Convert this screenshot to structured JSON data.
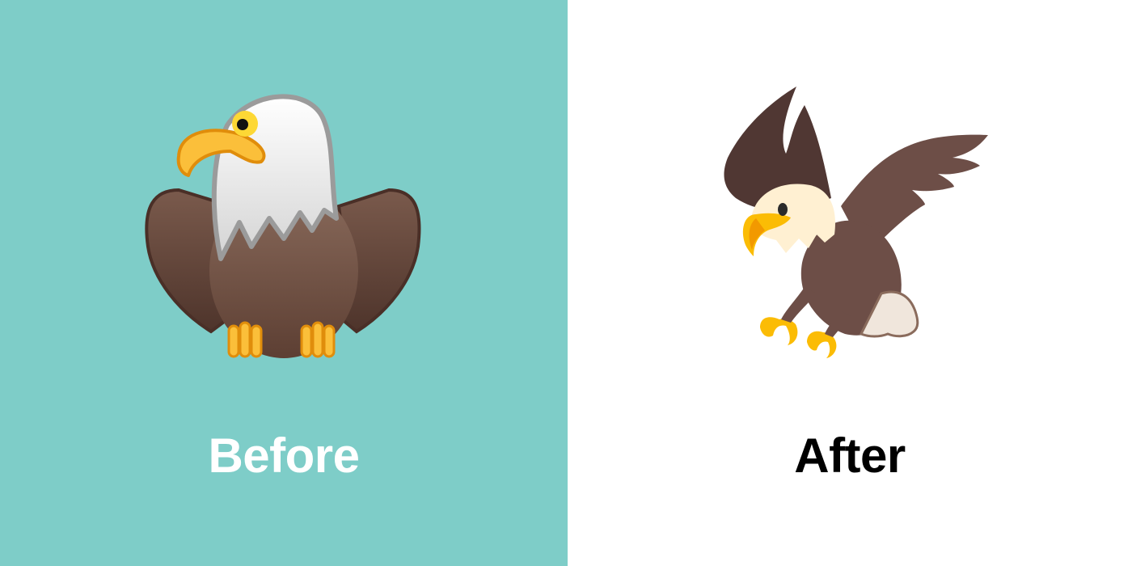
{
  "panels": {
    "before": {
      "label": "Before",
      "background": "#7ecdc8",
      "label_color": "#ffffff",
      "icon": "eagle-emoji-old-design"
    },
    "after": {
      "label": "After",
      "background": "#ffffff",
      "label_color": "#000000",
      "icon": "eagle-emoji-new-design"
    }
  }
}
